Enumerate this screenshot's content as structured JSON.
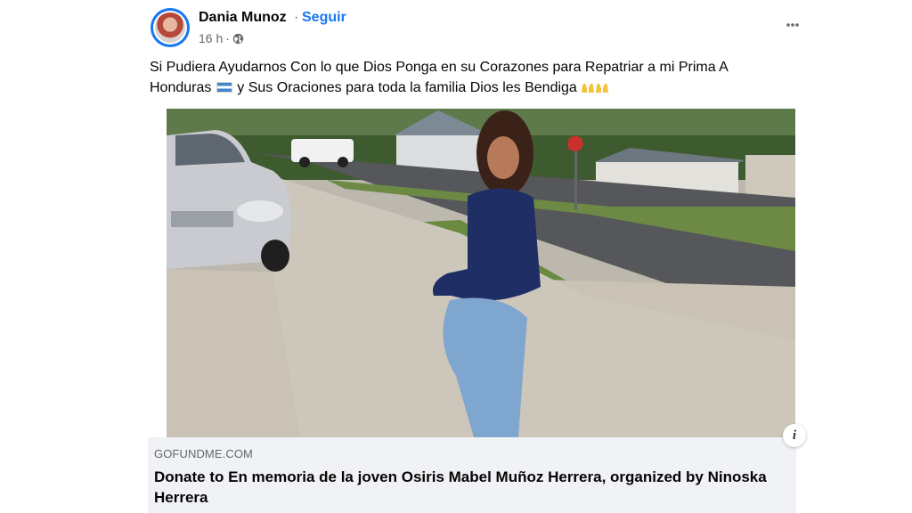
{
  "post": {
    "author_name": "Dania Munoz",
    "separator": "·",
    "follow_label": "Seguir",
    "timestamp": "16 h",
    "meta_dot": "·",
    "privacy_icon": "globe-icon",
    "more_icon": "more-options-icon",
    "text_part1": "Si Pudiera Ayudarnos Con lo que Dios Ponga en su Corazones para Repatriar a mi Prima A Honduras",
    "text_part2": "y Sus Oraciones para toda la familia Dios les Bendiga",
    "flag_icon": "honduras-flag-icon",
    "emoji_icon": "praising-hands-icon"
  },
  "link_preview": {
    "domain": "GOFUNDME.COM",
    "title": "Donate to En memoria de la joven Osiris Mabel Muñoz Herrera, organized by Ninoska Herrera",
    "corner_button_label": "i"
  },
  "colors": {
    "accent": "#1877f2",
    "secondary_text": "#65676b",
    "card_background": "#f0f2f5"
  }
}
